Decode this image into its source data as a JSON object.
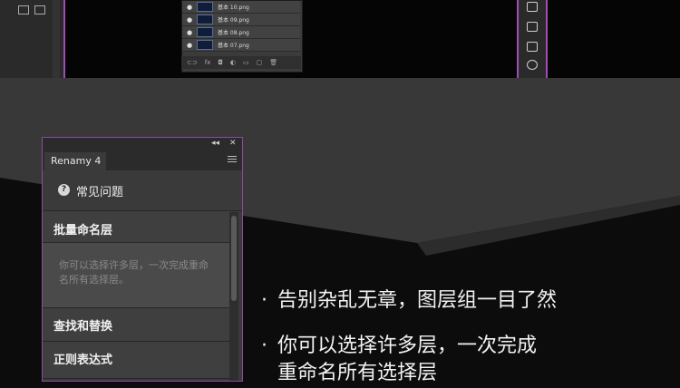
{
  "layers_panel": {
    "layers": [
      {
        "name": "基本 10.png"
      },
      {
        "name": "基本 09.png"
      },
      {
        "name": "基本 08.png"
      },
      {
        "name": "基本 07.png"
      }
    ],
    "footer_icons": [
      "link-icon",
      "fx-icon",
      "mask-icon",
      "adjustment-icon",
      "folder-icon",
      "new-layer-icon",
      "trash-icon"
    ]
  },
  "renamy_panel": {
    "tab_label": "Renamy 4",
    "collapse_glyph": "◂◂",
    "close_glyph": "✕",
    "faq_icon_glyph": "?",
    "faq_label": "常见问题",
    "sections": [
      {
        "title": "批量命名层",
        "description": "你可以选择许多层，一次完成重命名所有选择层。",
        "expanded": true
      },
      {
        "title": "查找和替换"
      },
      {
        "title": "正则表达式"
      }
    ]
  },
  "bullets": [
    {
      "text": "告别杂乱无章，图层组一目了然"
    },
    {
      "text": "你可以选择许多层，一次完成"
    },
    {
      "text": "重命名所有选择层"
    }
  ],
  "bullet_glyph": "·",
  "colors": {
    "accent_border": "#a24bb6",
    "panel_bg": "#3a3a3a",
    "page_bg": "#0c0c0c"
  }
}
